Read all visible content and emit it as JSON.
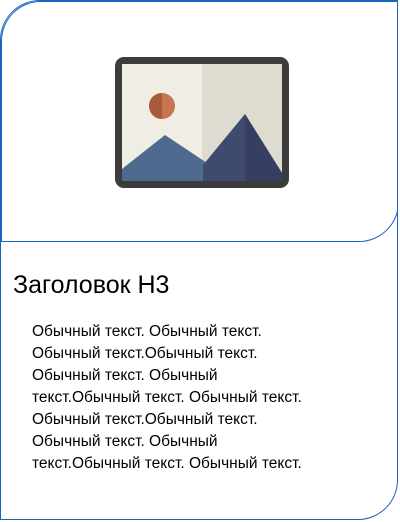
{
  "card": {
    "accent_color": "#1565c0",
    "media": {
      "icon": "image-placeholder-icon"
    },
    "heading": "Заголовок Н3",
    "body_lines": [
      "Обычный текст. Обычный текст.",
      "Обычный текст.Обычный текст.",
      "Обычный текст. Обычный",
      "текст.Обычный текст. Обычный текст.",
      "Обычный текст.Обычный текст.",
      "Обычный текст. Обычный",
      "текст.Обычный текст. Обычный текст."
    ]
  }
}
